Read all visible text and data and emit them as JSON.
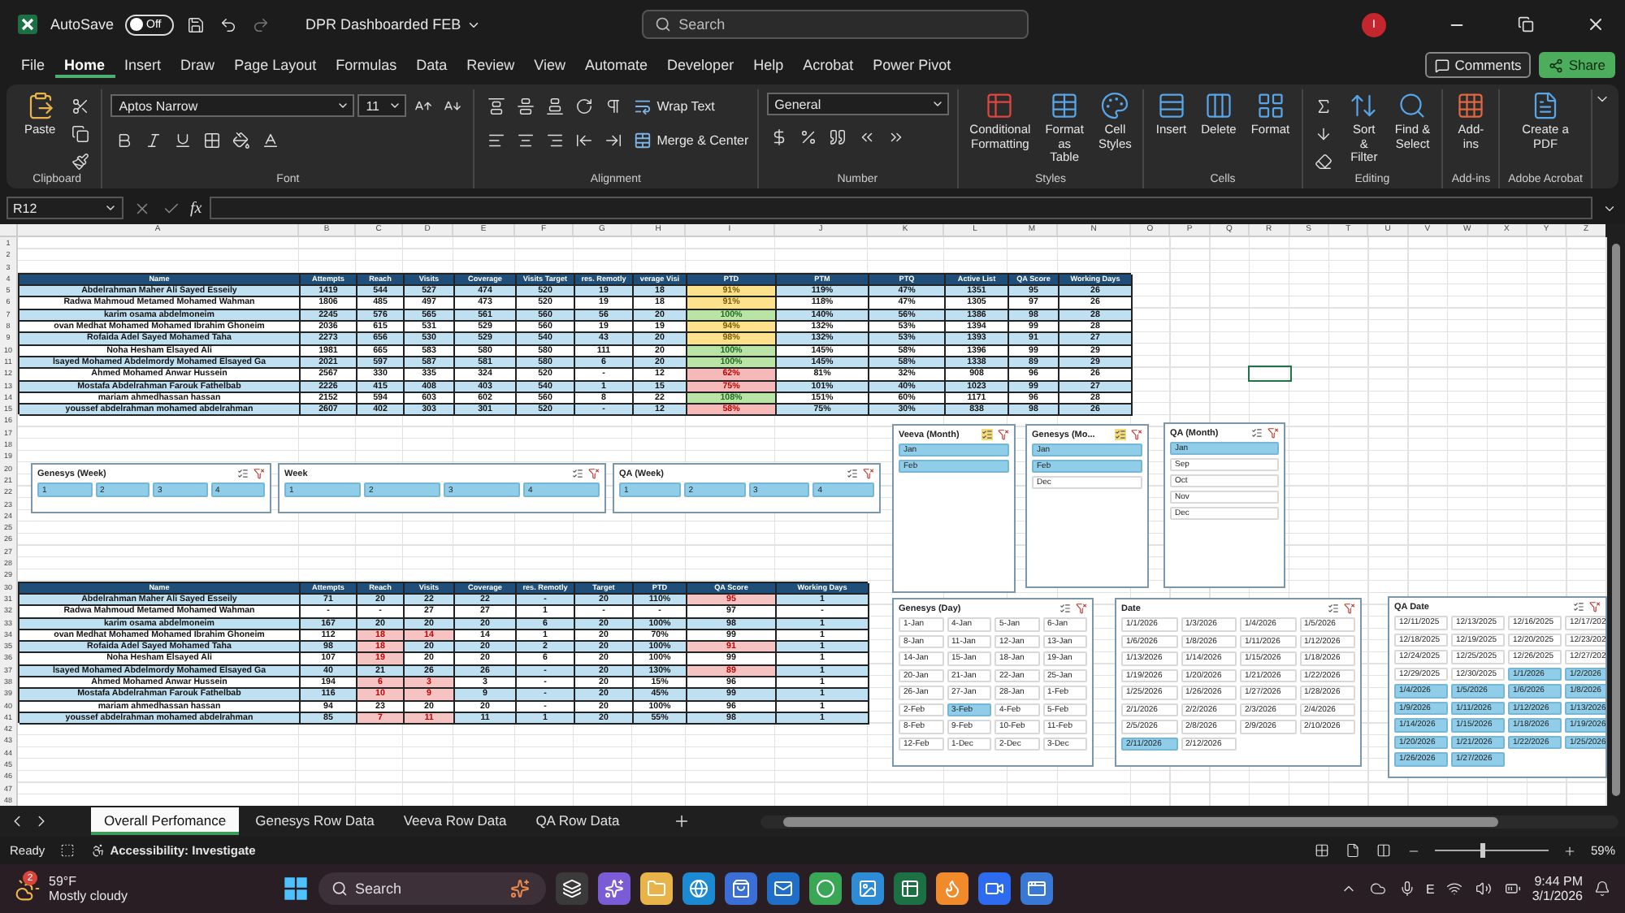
{
  "title_bar": {
    "autosave_label": "AutoSave",
    "autosave_state": "Off",
    "autosave_on": false,
    "file_name": "DPR Dashboarded FEB",
    "search_placeholder": "Search",
    "avatar_initial": "I"
  },
  "menu": {
    "tabs": [
      {
        "label": "File",
        "selected": false
      },
      {
        "label": "Home",
        "selected": true
      },
      {
        "label": "Insert",
        "selected": false
      },
      {
        "label": "Draw",
        "selected": false
      },
      {
        "label": "Page Layout",
        "selected": false
      },
      {
        "label": "Formulas",
        "selected": false
      },
      {
        "label": "Data",
        "selected": false
      },
      {
        "label": "Review",
        "selected": false
      },
      {
        "label": "View",
        "selected": false
      },
      {
        "label": "Automate",
        "selected": false
      },
      {
        "label": "Developer",
        "selected": false
      },
      {
        "label": "Help",
        "selected": false
      },
      {
        "label": "Acrobat",
        "selected": false
      },
      {
        "label": "Power Pivot",
        "selected": false
      }
    ],
    "comments": "Comments",
    "share": "Share"
  },
  "ribbon": {
    "groups": [
      {
        "label": "Clipboard",
        "items": [
          {
            "kind": "large",
            "label": "Paste"
          },
          {
            "kind": "rows",
            "rows": [
              [
                {
                  "kind": "icon"
                }
              ],
              [
                {
                  "kind": "icon"
                }
              ],
              [
                {
                  "kind": "icon"
                }
              ]
            ]
          }
        ]
      },
      {
        "label": "Font",
        "items": [
          {
            "kind": "rows",
            "rows": [
              [
                {
                  "kind": "field",
                  "value": "Aptos Narrow"
                },
                {
                  "kind": "field",
                  "value": "11"
                },
                {
                  "kind": "icon"
                },
                {
                  "kind": "icon"
                }
              ],
              [
                {
                  "kind": "icon"
                },
                {
                  "kind": "icon"
                },
                {
                  "kind": "icon"
                },
                {
                  "kind": "icon"
                },
                {
                  "kind": "icon"
                },
                {
                  "kind": "icon"
                }
              ]
            ]
          }
        ]
      },
      {
        "label": "Alignment",
        "items": [
          {
            "kind": "rows",
            "rows": [
              [
                {
                  "kind": "icon"
                },
                {
                  "kind": "icon"
                },
                {
                  "kind": "icon"
                },
                {
                  "kind": "icon"
                },
                {
                  "kind": "icon"
                }
              ],
              [
                {
                  "kind": "icon"
                },
                {
                  "kind": "icon"
                },
                {
                  "kind": "icon"
                },
                {
                  "kind": "icon"
                },
                {
                  "kind": "icon"
                }
              ]
            ]
          },
          {
            "kind": "rows",
            "rows": [
              [
                {
                  "kind": "inline",
                  "label": "Wrap Text"
                }
              ],
              [
                {
                  "kind": "inline",
                  "label": "Merge & Center"
                }
              ]
            ]
          }
        ]
      },
      {
        "label": "Number",
        "items": [
          {
            "kind": "rows",
            "rows": [
              [
                {
                  "kind": "field",
                  "value": "General"
                }
              ],
              [
                {
                  "kind": "icon"
                },
                {
                  "kind": "icon"
                },
                {
                  "kind": "icon"
                },
                {
                  "kind": "icon"
                },
                {
                  "kind": "icon"
                }
              ]
            ]
          }
        ]
      },
      {
        "label": "Styles",
        "items": [
          {
            "kind": "large",
            "label": "Conditional Formatting"
          },
          {
            "kind": "large",
            "label": "Format as Table"
          },
          {
            "kind": "large",
            "label": "Cell Styles"
          }
        ]
      },
      {
        "label": "Cells",
        "items": [
          {
            "kind": "large",
            "label": "Insert"
          },
          {
            "kind": "large",
            "label": "Delete"
          },
          {
            "kind": "large",
            "label": "Format"
          }
        ]
      },
      {
        "label": "Editing",
        "items": [
          {
            "kind": "rows",
            "rows": [
              [
                {
                  "kind": "icon"
                }
              ],
              [
                {
                  "kind": "icon"
                }
              ],
              [
                {
                  "kind": "icon"
                }
              ]
            ]
          },
          {
            "kind": "large",
            "label": "Sort & Filter"
          },
          {
            "kind": "large",
            "label": "Find & Select"
          }
        ]
      },
      {
        "label": "Add-ins",
        "items": [
          {
            "kind": "large",
            "label": "Add-ins"
          }
        ]
      },
      {
        "label": "Adobe Acrobat",
        "items": [
          {
            "kind": "large",
            "label": "Create a PDF"
          }
        ]
      }
    ]
  },
  "formula_bar": {
    "name_box": "R12",
    "fx": "fx"
  },
  "sheet": {
    "column_headers": [
      "A",
      "B",
      "C",
      "D",
      "E",
      "F",
      "G",
      "H",
      "I",
      "J",
      "K",
      "L",
      "M",
      "N",
      "O",
      "P",
      "Q",
      "R",
      "S",
      "T",
      "U",
      "V",
      "W",
      "X",
      "Y",
      "Z"
    ],
    "row_headers": [
      "1",
      "2",
      "3",
      "4",
      "5",
      "6",
      "7",
      "8",
      "9",
      "10",
      "11",
      "12",
      "13",
      "14",
      "15",
      "16",
      "17",
      "18",
      "19",
      "20",
      "21",
      "22",
      "23",
      "24",
      "25",
      "26",
      "27",
      "28",
      "29",
      "30",
      "31",
      "32",
      "33",
      "34",
      "35",
      "36",
      "37",
      "38",
      "39",
      "40",
      "41",
      "42",
      "43",
      "44",
      "45",
      "46",
      "47",
      "48"
    ],
    "monthly_table": {
      "columns": [
        "Name",
        "Attempts",
        "Reach",
        "Visits",
        "Coverage",
        "Visits Target",
        "res. Remotly",
        "verage Visi",
        "PTD",
        "PTM",
        "PTQ",
        "Active List",
        "QA Score",
        "Working Days"
      ],
      "rows": [
        {
          "cells": [
            "Abdelrahman Maher Ali Sayed Esseily",
            "1419",
            "544",
            "527",
            "474",
            "520",
            "19",
            "18",
            "91%",
            "119%",
            "47%",
            "1351",
            "95",
            "26"
          ],
          "color": "#fde18c"
        },
        {
          "cells": [
            "Radwa Mahmoud Metamed Mohamed Wahman",
            "1806",
            "485",
            "497",
            "473",
            "520",
            "19",
            "18",
            "91%",
            "118%",
            "47%",
            "1305",
            "97",
            "26"
          ],
          "color": "#fde18c"
        },
        {
          "cells": [
            "karim osama abdelmoneim",
            "2245",
            "576",
            "565",
            "561",
            "560",
            "56",
            "20",
            "100%",
            "140%",
            "56%",
            "1386",
            "98",
            "28"
          ],
          "color": "#b9e4a6"
        },
        {
          "cells": [
            "ovan Medhat Mohamed Mohamed Ibrahim Ghoneim",
            "2036",
            "615",
            "531",
            "529",
            "560",
            "19",
            "19",
            "94%",
            "132%",
            "53%",
            "1394",
            "99",
            "28"
          ],
          "color": "#fde18c"
        },
        {
          "cells": [
            "Rofaida Adel Sayed Mohamed Taha",
            "2273",
            "656",
            "530",
            "529",
            "540",
            "43",
            "20",
            "98%",
            "132%",
            "53%",
            "1393",
            "91",
            "27"
          ],
          "color": "#fde18c"
        },
        {
          "cells": [
            "Noha Hesham Elsayed Ali",
            "1981",
            "665",
            "583",
            "580",
            "580",
            "111",
            "20",
            "100%",
            "145%",
            "58%",
            "1396",
            "99",
            "29"
          ],
          "color": "#b9e4a6"
        },
        {
          "cells": [
            "lsayed Mohamed Abdelmordy Mohamed Elsayed Ga",
            "2021",
            "597",
            "587",
            "581",
            "580",
            "6",
            "20",
            "100%",
            "145%",
            "58%",
            "1338",
            "89",
            "29"
          ],
          "color": "#b9e4a6"
        },
        {
          "cells": [
            "Ahmed Mohamed Anwar Hussein",
            "2567",
            "330",
            "335",
            "324",
            "520",
            "-",
            "12",
            "62%",
            "81%",
            "32%",
            "908",
            "96",
            "26"
          ],
          "color": "#f6b9b9"
        },
        {
          "cells": [
            "Mostafa Abdelrahman Farouk Fathelbab",
            "2226",
            "415",
            "408",
            "403",
            "540",
            "1",
            "15",
            "75%",
            "101%",
            "40%",
            "1023",
            "99",
            "27"
          ],
          "color": "#f6b9b9"
        },
        {
          "cells": [
            "mariam ahmedhassan hassan",
            "2152",
            "594",
            "603",
            "602",
            "560",
            "8",
            "22",
            "108%",
            "151%",
            "60%",
            "1171",
            "96",
            "28"
          ],
          "color": "#b9e4a6"
        },
        {
          "cells": [
            "youssef abdelrahman mohamed abdelrahman",
            "2607",
            "402",
            "303",
            "301",
            "520",
            "-",
            "12",
            "58%",
            "75%",
            "30%",
            "838",
            "98",
            "26"
          ],
          "color": "#f6b9b9"
        }
      ]
    },
    "daily_table": {
      "columns": [
        "Name",
        "Attempts",
        "Reach",
        "Visits",
        "Coverage",
        "res. Remotly",
        "Target",
        "PTD",
        "QA Score",
        "Working Days"
      ],
      "rows": [
        {
          "cells": [
            "Abdelrahman Maher Ali Sayed Esseily",
            "71",
            "20",
            "22",
            "22",
            "-",
            "20",
            "110%",
            "95",
            "1"
          ],
          "reach_low": false,
          "visits_low": false,
          "qa_low": true
        },
        {
          "cells": [
            "Radwa Mahmoud Metamed Mohamed Wahman",
            "-",
            "-",
            "27",
            "27",
            "1",
            "-",
            "-",
            "97",
            "-"
          ],
          "reach_low": false,
          "visits_low": false,
          "qa_low": false
        },
        {
          "cells": [
            "karim osama abdelmoneim",
            "167",
            "20",
            "20",
            "20",
            "6",
            "20",
            "100%",
            "98",
            "1"
          ],
          "reach_low": false,
          "visits_low": false,
          "qa_low": false
        },
        {
          "cells": [
            "ovan Medhat Mohamed Mohamed Ibrahim Ghoneim",
            "112",
            "18",
            "14",
            "14",
            "1",
            "20",
            "70%",
            "99",
            "1"
          ],
          "reach_low": true,
          "visits_low": true,
          "qa_low": false
        },
        {
          "cells": [
            "Rofaida Adel Sayed Mohamed Taha",
            "98",
            "18",
            "20",
            "20",
            "2",
            "20",
            "100%",
            "91",
            "1"
          ],
          "reach_low": true,
          "visits_low": false,
          "qa_low": true
        },
        {
          "cells": [
            "Noha Hesham Elsayed Ali",
            "107",
            "19",
            "20",
            "20",
            "6",
            "20",
            "100%",
            "99",
            "1"
          ],
          "reach_low": true,
          "visits_low": false,
          "qa_low": false
        },
        {
          "cells": [
            "lsayed Mohamed Abdelmordy Mohamed Elsayed Ga",
            "40",
            "21",
            "26",
            "26",
            "-",
            "20",
            "130%",
            "89",
            "1"
          ],
          "reach_low": false,
          "visits_low": false,
          "qa_low": true
        },
        {
          "cells": [
            "Ahmed Mohamed Anwar Hussein",
            "194",
            "6",
            "3",
            "3",
            "-",
            "20",
            "15%",
            "96",
            "1"
          ],
          "reach_low": true,
          "visits_low": true,
          "qa_low": false
        },
        {
          "cells": [
            "Mostafa Abdelrahman Farouk Fathelbab",
            "116",
            "10",
            "9",
            "9",
            "-",
            "20",
            "45%",
            "99",
            "1"
          ],
          "reach_low": true,
          "visits_low": true,
          "qa_low": false
        },
        {
          "cells": [
            "mariam ahmedhassan hassan",
            "94",
            "23",
            "20",
            "20",
            "-",
            "20",
            "100%",
            "96",
            "1"
          ],
          "reach_low": false,
          "visits_low": false,
          "qa_low": false
        },
        {
          "cells": [
            "youssef abdelrahman mohamed abdelrahman",
            "85",
            "7",
            "11",
            "11",
            "1",
            "20",
            "55%",
            "98",
            "1"
          ],
          "reach_low": true,
          "visits_low": true,
          "qa_low": false
        }
      ]
    },
    "slicers": [
      {
        "title": "Genesys (Week)",
        "kind": "horizontal",
        "multi_select": false,
        "items": [
          {
            "label": "1",
            "selected": true
          },
          {
            "label": "2",
            "selected": true
          },
          {
            "label": "3",
            "selected": true
          },
          {
            "label": "4",
            "selected": true
          }
        ]
      },
      {
        "title": "Week",
        "kind": "horizontal",
        "multi_select": false,
        "items": [
          {
            "label": "1",
            "selected": true
          },
          {
            "label": "2",
            "selected": true
          },
          {
            "label": "3",
            "selected": true
          },
          {
            "label": "4",
            "selected": true
          }
        ]
      },
      {
        "title": "QA (Week)",
        "kind": "horizontal",
        "multi_select": false,
        "items": [
          {
            "label": "1",
            "selected": true
          },
          {
            "label": "2",
            "selected": true
          },
          {
            "label": "3",
            "selected": true
          },
          {
            "label": "4",
            "selected": true
          }
        ]
      },
      {
        "title": "Veeva (Month)",
        "kind": "list",
        "multi_select": true,
        "items": [
          {
            "label": "Jan",
            "selected": true
          },
          {
            "label": "Feb",
            "selected": true
          }
        ]
      },
      {
        "title": "Genesys (Mo...",
        "kind": "list",
        "multi_select": true,
        "items": [
          {
            "label": "Jan",
            "selected": true
          },
          {
            "label": "Feb",
            "selected": true
          },
          {
            "label": "Dec",
            "selected": false
          }
        ]
      },
      {
        "title": "QA (Month)",
        "kind": "list",
        "multi_select": false,
        "items": [
          {
            "label": "Jan",
            "selected": true
          },
          {
            "label": "Sep",
            "selected": false
          },
          {
            "label": "Oct",
            "selected": false
          },
          {
            "label": "Nov",
            "selected": false
          },
          {
            "label": "Dec",
            "selected": false
          }
        ]
      },
      {
        "title": "Genesys (Day)",
        "kind": "grid",
        "multi_select": false,
        "items": [
          {
            "label": "1-Jan",
            "selected": false
          },
          {
            "label": "4-Jan",
            "selected": false
          },
          {
            "label": "5-Jan",
            "selected": false
          },
          {
            "label": "6-Jan",
            "selected": false
          },
          {
            "label": "8-Jan",
            "selected": false
          },
          {
            "label": "11-Jan",
            "selected": false
          },
          {
            "label": "12-Jan",
            "selected": false
          },
          {
            "label": "13-Jan",
            "selected": false
          },
          {
            "label": "14-Jan",
            "selected": false
          },
          {
            "label": "15-Jan",
            "selected": false
          },
          {
            "label": "18-Jan",
            "selected": false
          },
          {
            "label": "19-Jan",
            "selected": false
          },
          {
            "label": "20-Jan",
            "selected": false
          },
          {
            "label": "21-Jan",
            "selected": false
          },
          {
            "label": "22-Jan",
            "selected": false
          },
          {
            "label": "25-Jan",
            "selected": false
          },
          {
            "label": "26-Jan",
            "selected": false
          },
          {
            "label": "27-Jan",
            "selected": false
          },
          {
            "label": "28-Jan",
            "selected": false
          },
          {
            "label": "1-Feb",
            "selected": false
          },
          {
            "label": "2-Feb",
            "selected": false
          },
          {
            "label": "3-Feb",
            "selected": true
          },
          {
            "label": "4-Feb",
            "selected": false
          },
          {
            "label": "5-Feb",
            "selected": false
          },
          {
            "label": "8-Feb",
            "selected": false
          },
          {
            "label": "9-Feb",
            "selected": false
          },
          {
            "label": "10-Feb",
            "selected": false
          },
          {
            "label": "11-Feb",
            "selected": false
          },
          {
            "label": "12-Feb",
            "selected": false
          },
          {
            "label": "1-Dec",
            "selected": false
          },
          {
            "label": "2-Dec",
            "selected": false
          },
          {
            "label": "3-Dec",
            "selected": false
          }
        ]
      },
      {
        "title": "Date",
        "kind": "grid",
        "multi_select": false,
        "items": [
          {
            "label": "1/1/2026",
            "selected": false
          },
          {
            "label": "1/3/2026",
            "selected": false
          },
          {
            "label": "1/4/2026",
            "selected": false
          },
          {
            "label": "1/5/2026",
            "selected": false
          },
          {
            "label": "1/6/2026",
            "selected": false
          },
          {
            "label": "1/8/2026",
            "selected": false
          },
          {
            "label": "1/11/2026",
            "selected": false
          },
          {
            "label": "1/12/2026",
            "selected": false
          },
          {
            "label": "1/13/2026",
            "selected": false
          },
          {
            "label": "1/14/2026",
            "selected": false
          },
          {
            "label": "1/15/2026",
            "selected": false
          },
          {
            "label": "1/18/2026",
            "selected": false
          },
          {
            "label": "1/19/2026",
            "selected": false
          },
          {
            "label": "1/20/2026",
            "selected": false
          },
          {
            "label": "1/21/2026",
            "selected": false
          },
          {
            "label": "1/22/2026",
            "selected": false
          },
          {
            "label": "1/25/2026",
            "selected": false
          },
          {
            "label": "1/26/2026",
            "selected": false
          },
          {
            "label": "1/27/2026",
            "selected": false
          },
          {
            "label": "1/28/2026",
            "selected": false
          },
          {
            "label": "2/1/2026",
            "selected": false
          },
          {
            "label": "2/2/2026",
            "selected": false
          },
          {
            "label": "2/3/2026",
            "selected": false
          },
          {
            "label": "2/4/2026",
            "selected": false
          },
          {
            "label": "2/5/2026",
            "selected": false
          },
          {
            "label": "2/8/2026",
            "selected": false
          },
          {
            "label": "2/9/2026",
            "selected": false
          },
          {
            "label": "2/10/2026",
            "selected": false
          },
          {
            "label": "2/11/2026",
            "selected": true
          },
          {
            "label": "2/12/2026",
            "selected": false
          }
        ]
      },
      {
        "title": "QA Date",
        "kind": "grid",
        "multi_select": false,
        "items": [
          {
            "label": "12/11/2025",
            "selected": false
          },
          {
            "label": "12/13/2025",
            "selected": false
          },
          {
            "label": "12/16/2025",
            "selected": false
          },
          {
            "label": "12/17/202",
            "selected": false
          },
          {
            "label": "12/18/2025",
            "selected": false
          },
          {
            "label": "12/19/2025",
            "selected": false
          },
          {
            "label": "12/20/2025",
            "selected": false
          },
          {
            "label": "12/23/202",
            "selected": false
          },
          {
            "label": "12/24/2025",
            "selected": false
          },
          {
            "label": "12/25/2025",
            "selected": false
          },
          {
            "label": "12/26/2025",
            "selected": false
          },
          {
            "label": "12/27/202",
            "selected": false
          },
          {
            "label": "12/29/2025",
            "selected": false
          },
          {
            "label": "12/30/2025",
            "selected": false
          },
          {
            "label": "1/1/2026",
            "selected": true
          },
          {
            "label": "1/2/2026",
            "selected": true
          },
          {
            "label": "1/4/2026",
            "selected": true
          },
          {
            "label": "1/5/2026",
            "selected": true
          },
          {
            "label": "1/6/2026",
            "selected": true
          },
          {
            "label": "1/8/2026",
            "selected": true
          },
          {
            "label": "1/9/2026",
            "selected": true
          },
          {
            "label": "1/11/2026",
            "selected": true
          },
          {
            "label": "1/12/2026",
            "selected": true
          },
          {
            "label": "1/13/2026",
            "selected": true
          },
          {
            "label": "1/14/2026",
            "selected": true
          },
          {
            "label": "1/15/2026",
            "selected": true
          },
          {
            "label": "1/18/2026",
            "selected": true
          },
          {
            "label": "1/19/2026",
            "selected": true
          },
          {
            "label": "1/20/2026",
            "selected": true
          },
          {
            "label": "1/21/2026",
            "selected": true
          },
          {
            "label": "1/22/2026",
            "selected": true
          },
          {
            "label": "1/25/2026",
            "selected": true
          },
          {
            "label": "1/26/2026",
            "selected": true
          },
          {
            "label": "1/27/2026",
            "selected": true
          }
        ]
      }
    ]
  },
  "sheet_tabs": [
    {
      "label": "Overall Perfomance",
      "selected": true
    },
    {
      "label": "Genesys Row Data",
      "selected": false
    },
    {
      "label": "Veeva Row Data",
      "selected": false
    },
    {
      "label": "QA Row Data",
      "selected": false
    }
  ],
  "status_bar": {
    "mode": "Ready",
    "accessibility": "Accessibility: Investigate",
    "zoom": {
      "level": 0.4,
      "reading": "59%"
    }
  },
  "taskbar": {
    "weather_badge": "2",
    "temperature": "59°F",
    "condition": "Mostly cloudy",
    "search_placeholder": "Search",
    "input_indicator": "E",
    "time": "9:44 PM",
    "date": "3/1/2026"
  }
}
